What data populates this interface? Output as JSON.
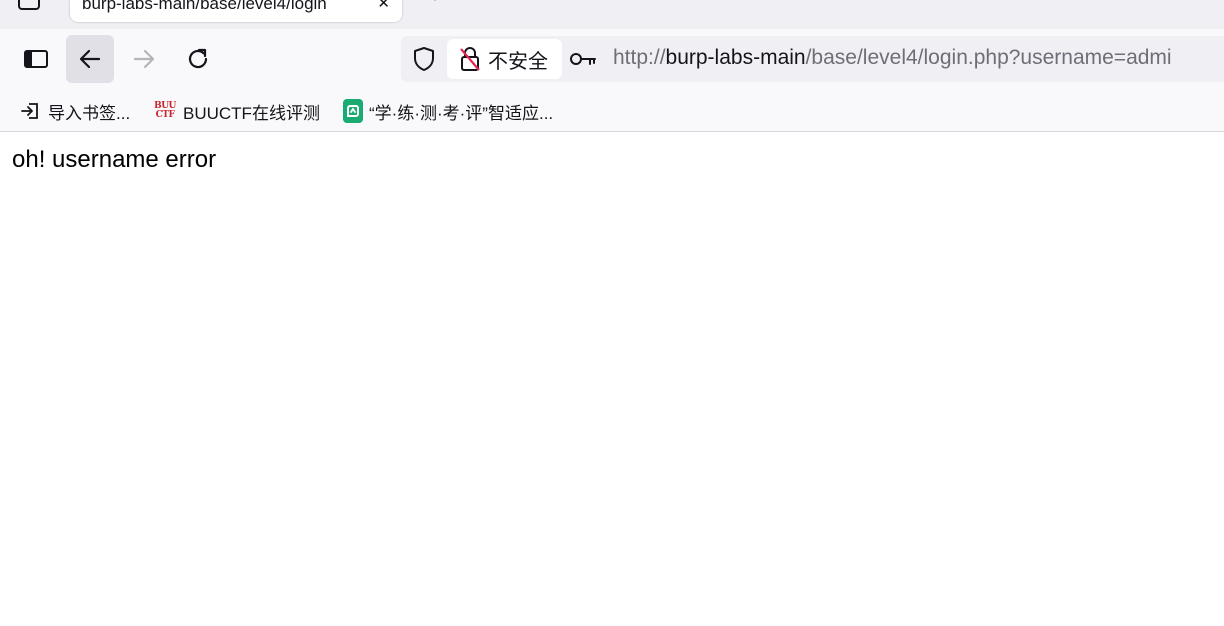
{
  "tab": {
    "title": "burp-labs-main/base/level4/login",
    "close_glyph": "✕",
    "new_tab_glyph": "+"
  },
  "navigation": {
    "sidebar_icon": "sidebar-icon",
    "back_icon": "back-arrow-icon",
    "forward_icon": "forward-arrow-icon",
    "reload_icon": "reload-icon"
  },
  "urlbar": {
    "security_label": "不安全",
    "url_scheme": "http://",
    "url_host": "burp-labs-main",
    "url_path": "/base/level4/login.php?username=admi"
  },
  "bookmarks": [
    {
      "label": "导入书签...",
      "icon": "import-icon"
    },
    {
      "label": "BUUCTF在线评测",
      "icon": "buuctf-logo"
    },
    {
      "label": "“学·练·测·考·评”智适应...",
      "icon": "green-app-logo"
    }
  ],
  "page": {
    "message": "oh! username error"
  },
  "colors": {
    "chrome_background": "#f9f9fb",
    "tabstrip_background": "#f0f0f4",
    "buuctf_red": "#c8242b",
    "app_green": "#1aab72"
  }
}
